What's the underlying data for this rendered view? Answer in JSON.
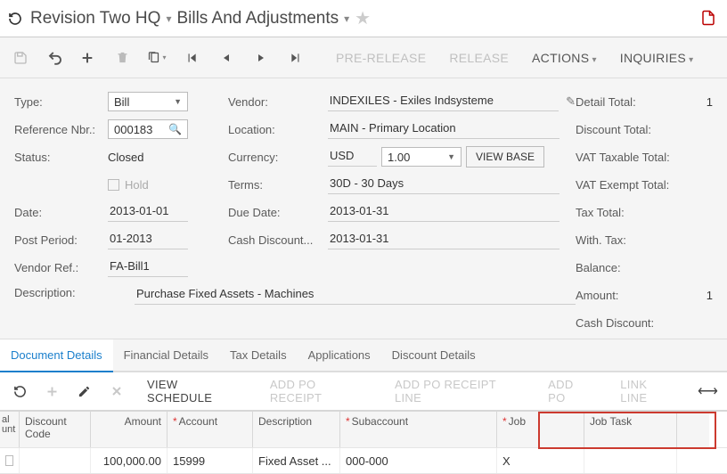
{
  "breadcrumb": {
    "item1": "Revision Two HQ",
    "item2": "Bills And Adjustments"
  },
  "toolbar": {
    "prerelease": "PRE-RELEASE",
    "release": "RELEASE",
    "actions": "ACTIONS",
    "inquiries": "INQUIRIES"
  },
  "form": {
    "type_lbl": "Type:",
    "type_val": "Bill",
    "refnbr_lbl": "Reference Nbr.:",
    "refnbr_val": "000183",
    "status_lbl": "Status:",
    "status_val": "Closed",
    "hold_lbl": "Hold",
    "date_lbl": "Date:",
    "date_val": "2013-01-01",
    "postperiod_lbl": "Post Period:",
    "postperiod_val": "01-2013",
    "vendorref_lbl": "Vendor Ref.:",
    "vendorref_val": "FA-Bill1",
    "desc_lbl": "Description:",
    "desc_val": "Purchase Fixed Assets - Machines",
    "vendor_lbl": "Vendor:",
    "vendor_val": "INDEXILES - Exiles Indsysteme",
    "location_lbl": "Location:",
    "location_val": "MAIN - Primary Location",
    "currency_lbl": "Currency:",
    "currency_code": "USD",
    "currency_rate": "1.00",
    "viewbase": "VIEW BASE",
    "terms_lbl": "Terms:",
    "terms_val": "30D - 30 Days",
    "duedate_lbl": "Due Date:",
    "duedate_val": "2013-01-31",
    "cashdisc_lbl": "Cash Discount...",
    "cashdisc_val": "2013-01-31",
    "detailtotal_lbl": "Detail Total:",
    "detailtotal_val": "1",
    "disctotal_lbl": "Discount Total:",
    "vattax_lbl": "VAT Taxable Total:",
    "vatexempt_lbl": "VAT Exempt Total:",
    "taxtotal_lbl": "Tax Total:",
    "withtax_lbl": "With. Tax:",
    "balance_lbl": "Balance:",
    "amount_lbl": "Amount:",
    "amount_val": "1",
    "cashdiscount_lbl": "Cash Discount:"
  },
  "tabs": {
    "docdetails": "Document Details",
    "findetails": "Financial Details",
    "taxdetails": "Tax Details",
    "applications": "Applications",
    "discdetails": "Discount Details"
  },
  "gridtb": {
    "viewsched": "VIEW SCHEDULE",
    "addporeceipt": "ADD PO RECEIPT",
    "addporeceiptline": "ADD PO RECEIPT LINE",
    "addpo": "ADD PO",
    "linkline": "LINK LINE"
  },
  "gridhead": {
    "c0a": "al",
    "c0b": "unt",
    "disccode": "Discount Code",
    "amount": "Amount",
    "account": "Account",
    "description": "Description",
    "subaccount": "Subaccount",
    "job": "Job",
    "jobtask": "Job Task"
  },
  "gridrow": {
    "amount": "100,000.00",
    "account": "15999",
    "description": "Fixed Asset ...",
    "subaccount": "000-000",
    "job": "X"
  }
}
